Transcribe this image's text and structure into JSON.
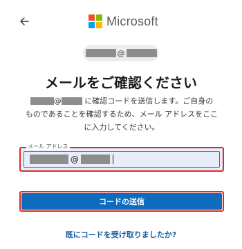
{
  "header": {
    "back_icon": "arrow-left-icon",
    "logo_text": "Microsoft",
    "logo_colors": [
      "#f25022",
      "#7fba00",
      "#00a4ef",
      "#ffb900"
    ]
  },
  "identity": {
    "at_sign": "@"
  },
  "page": {
    "title": "メールをご確認ください",
    "description_line1": " に確認コードを送信します。ご自身の",
    "description_line2": "ものであることを確認するため、メール アドレスをここ",
    "description_line3": "に入力してください。",
    "description_at": "@"
  },
  "email_field": {
    "label": "メール アドレス",
    "at_sign": "@"
  },
  "buttons": {
    "submit_label": "コードの送信",
    "submit_color": "#0f6cbd"
  },
  "links": {
    "already_received": "既にコードを受け取りましたか?"
  }
}
